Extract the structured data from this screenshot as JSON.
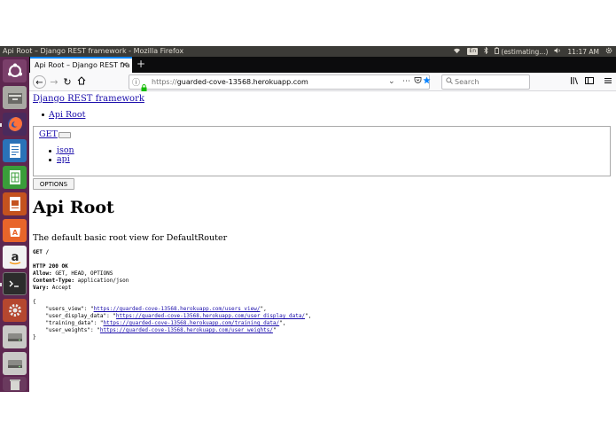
{
  "system_bar": {
    "window_title": "Api Root – Django REST framework - Mozilla Firefox",
    "keyboard": "En",
    "battery": "(estimating...)",
    "clock": "11:17 AM"
  },
  "browser": {
    "tab_title": "Api Root – Django REST fra",
    "url_secure_part": "https://",
    "url_host": "guarded-cove-13568.herokuapp.com",
    "search_placeholder": "Search"
  },
  "page": {
    "brand": "Django REST framework",
    "breadcrumb": "Api Root",
    "get_link": "GET",
    "format_links": [
      "json",
      "api"
    ],
    "options_label": "OPTIONS",
    "title": "Api Root",
    "description": "The default basic root view for DefaultRouter",
    "request_line": "GET /",
    "response": {
      "status": "HTTP 200 OK",
      "headers": [
        {
          "name": "Allow:",
          "value": "GET, HEAD, OPTIONS"
        },
        {
          "name": "Content-Type:",
          "value": "application/json"
        },
        {
          "name": "Vary:",
          "value": "Accept"
        }
      ],
      "open_brace": "{",
      "close_brace": "}",
      "entries": [
        {
          "key": "    \"users_view\": \"",
          "url": "https://guarded-cove-13568.herokuapp.com/users_view/",
          "tail": "\","
        },
        {
          "key": "    \"user_display_data\": \"",
          "url": "https://guarded-cove-13568.herokuapp.com/user_display_data/",
          "tail": "\","
        },
        {
          "key": "    \"training_data\": \"",
          "url": "https://guarded-cove-13568.herokuapp.com/training_data/",
          "tail": "\","
        },
        {
          "key": "    \"user_weights\": \"",
          "url": "https://guarded-cove-13568.herokuapp.com/user_weights/",
          "tail": "\""
        }
      ]
    }
  },
  "launcher_icons": [
    "ubuntu-dash-icon",
    "files-icon",
    "firefox-icon",
    "writer-icon",
    "calc-icon",
    "impress-icon",
    "software-center-icon",
    "amazon-icon",
    "terminal-icon",
    "settings-icon",
    "drive-icon",
    "drive-icon",
    "trash-icon"
  ],
  "colors": {
    "launcher": "#5e2750",
    "link": "#1a0dab",
    "tab_accent": "#0a84ff",
    "bookmark_star": "#0a84ff"
  }
}
